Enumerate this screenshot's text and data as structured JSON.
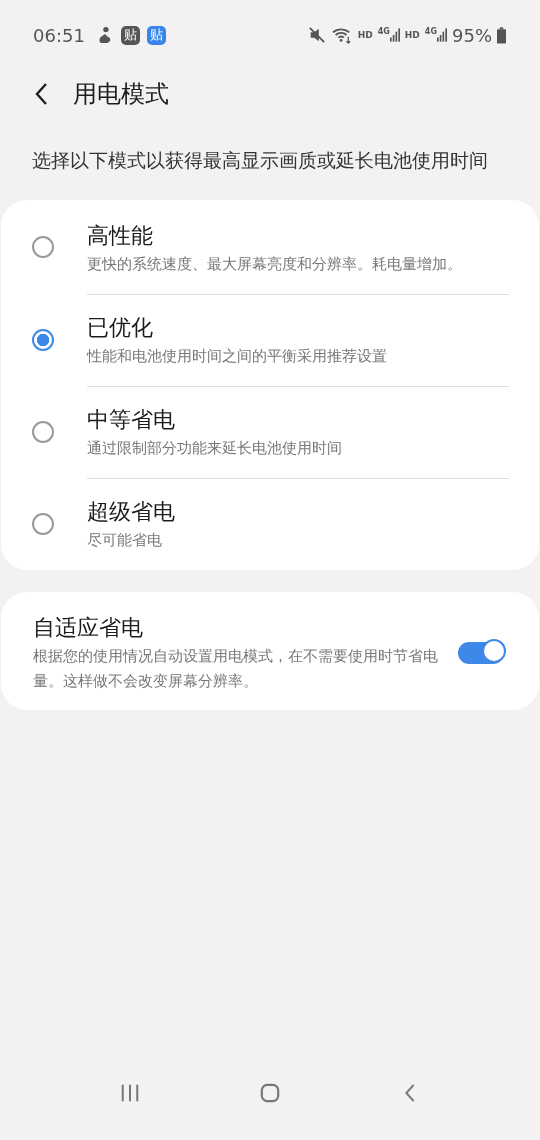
{
  "status_bar": {
    "time": "06:51",
    "notification_icons": [
      {
        "kind": "figure"
      },
      {
        "kind": "dark",
        "label": "贴"
      },
      {
        "kind": "blue",
        "label": "贴"
      }
    ],
    "sims": [
      {
        "hd": "HD",
        "network": "4G"
      },
      {
        "hd": "HD",
        "network": "4G"
      }
    ],
    "battery": "95%"
  },
  "header": {
    "title": "用电模式"
  },
  "description": "选择以下模式以获得最高显示画质或延长电池使用时间",
  "modes": [
    {
      "title": "高性能",
      "subtitle": "更快的系统速度、最大屏幕亮度和分辨率。耗电量增加。",
      "selected": false
    },
    {
      "title": "已优化",
      "subtitle": "性能和电池使用时间之间的平衡采用推荐设置",
      "selected": true
    },
    {
      "title": "中等省电",
      "subtitle": "通过限制部分功能来延长电池使用时间",
      "selected": false
    },
    {
      "title": "超级省电",
      "subtitle": "尽可能省电",
      "selected": false
    }
  ],
  "adaptive": {
    "title": "自适应省电",
    "description": "根据您的使用情况自动设置用电模式，在不需要使用时节省电量。这样做不会改变屏幕分辨率。",
    "on": true
  }
}
